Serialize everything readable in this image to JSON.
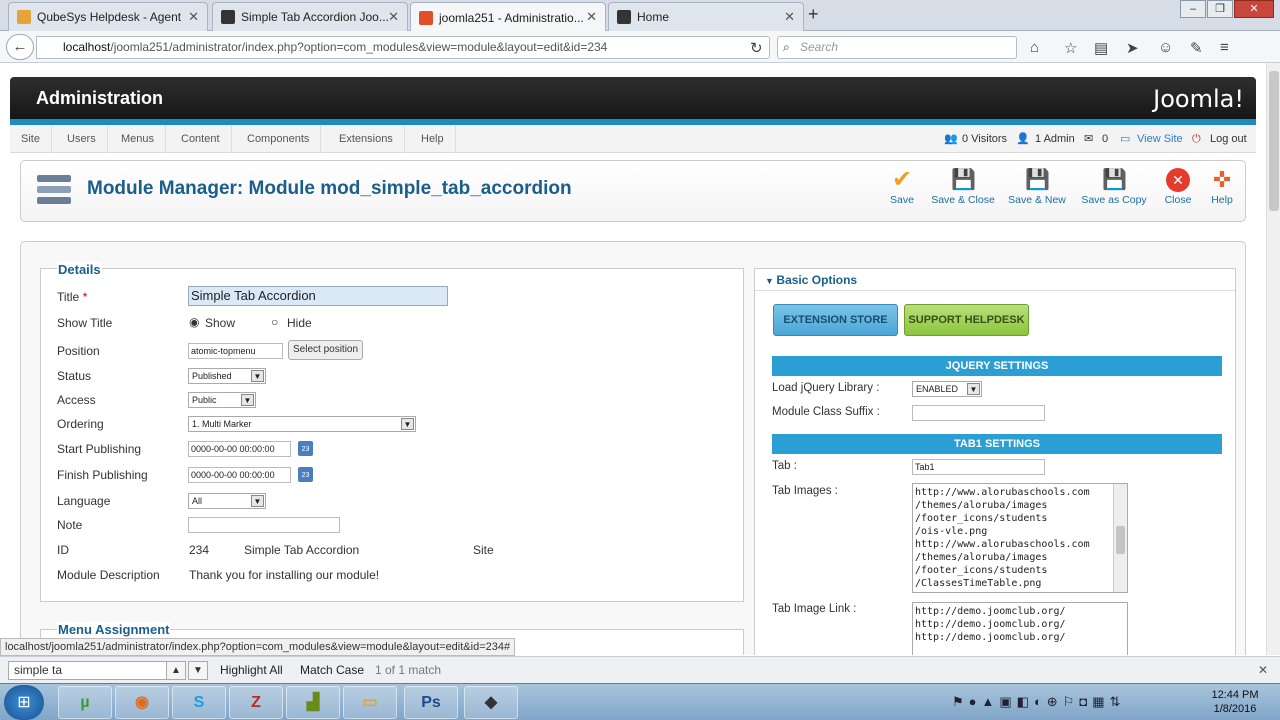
{
  "browser": {
    "tabs": [
      {
        "title": "QubeSys Helpdesk - Agent"
      },
      {
        "title": "Simple Tab Accordion Joo..."
      },
      {
        "title": "joomla251 - Administratio..."
      },
      {
        "title": "Home"
      }
    ],
    "url_host": "localhost",
    "url_path": "/joomla251/administrator/index.php?option=com_modules&view=module&layout=edit&id=234",
    "search_placeholder": "Search"
  },
  "admin": {
    "title": "Administration",
    "logo": "Joomla!",
    "menu": [
      "Site",
      "Users",
      "Menus",
      "Content",
      "Components",
      "Extensions",
      "Help"
    ],
    "status": {
      "visitors": "0 Visitors",
      "admins": "1 Admin",
      "messages": "0",
      "view_site": "View Site",
      "logout": "Log out"
    }
  },
  "toolbar": {
    "page_title": "Module Manager: Module mod_simple_tab_accordion",
    "buttons": [
      {
        "label": "Save",
        "icon": "check-icon"
      },
      {
        "label": "Save & Close",
        "icon": "disk-icon"
      },
      {
        "label": "Save & New",
        "icon": "disk-new-icon"
      },
      {
        "label": "Save as Copy",
        "icon": "disk-copy-icon"
      },
      {
        "label": "Close",
        "icon": "close-icon"
      },
      {
        "label": "Help",
        "icon": "help-icon"
      }
    ]
  },
  "details": {
    "legend": "Details",
    "title_label": "Title",
    "title_value": "Simple Tab Accordion",
    "show_title_label": "Show Title",
    "show_label": "Show",
    "hide_label": "Hide",
    "position_label": "Position",
    "position_value": "atomic-topmenu",
    "select_position": "Select position",
    "status_label": "Status",
    "status_value": "Published",
    "access_label": "Access",
    "access_value": "Public",
    "ordering_label": "Ordering",
    "ordering_value": "1. Multi Marker",
    "start_label": "Start Publishing",
    "start_value": "0000-00-00 00:00:00",
    "finish_label": "Finish Publishing",
    "finish_value": "0000-00-00 00:00:00",
    "language_label": "Language",
    "language_value": "All",
    "note_label": "Note",
    "id_label": "ID",
    "id_value": "234",
    "id_name": "Simple Tab Accordion",
    "id_client": "Site",
    "desc_label": "Module Description",
    "desc_value": "Thank you for installing our module!"
  },
  "menu_assignment": {
    "legend": "Menu Assignment"
  },
  "basic": {
    "header": "Basic Options",
    "ext_store": "EXTENSION STORE",
    "support": "SUPPORT HELPDESK",
    "jquery_section": "JQUERY SETTINGS",
    "load_jquery_label": "Load jQuery Library :",
    "load_jquery_value": "ENABLED",
    "class_suffix_label": "Module Class Suffix :",
    "tab1_section": "TAB1 SETTINGS",
    "tab_label": "Tab :",
    "tab_value": "Tab1",
    "tab_images_label": "Tab Images :",
    "tab_images_value": "http://www.alorubaschools.com\n/themes/aloruba/images\n/footer_icons/students\n/ois-vle.png\nhttp://www.alorubaschools.com\n/themes/aloruba/images\n/footer_icons/students\n/ClassesTimeTable.png",
    "tab_link_label": "Tab Image Link :",
    "tab_link_value": "http://demo.joomclub.org/\nhttp://demo.joomclub.org/\nhttp://demo.joomclub.org/"
  },
  "statusbar": {
    "url": "localhost/joomla251/administrator/index.php?option=com_modules&view=module&layout=edit&id=234#"
  },
  "findbar": {
    "query": "simple ta",
    "highlight": "Highlight All",
    "match_case": "Match Case",
    "result": "1 of 1 match"
  },
  "taskbar": {
    "time": "12:44 PM",
    "date": "1/8/2016"
  }
}
